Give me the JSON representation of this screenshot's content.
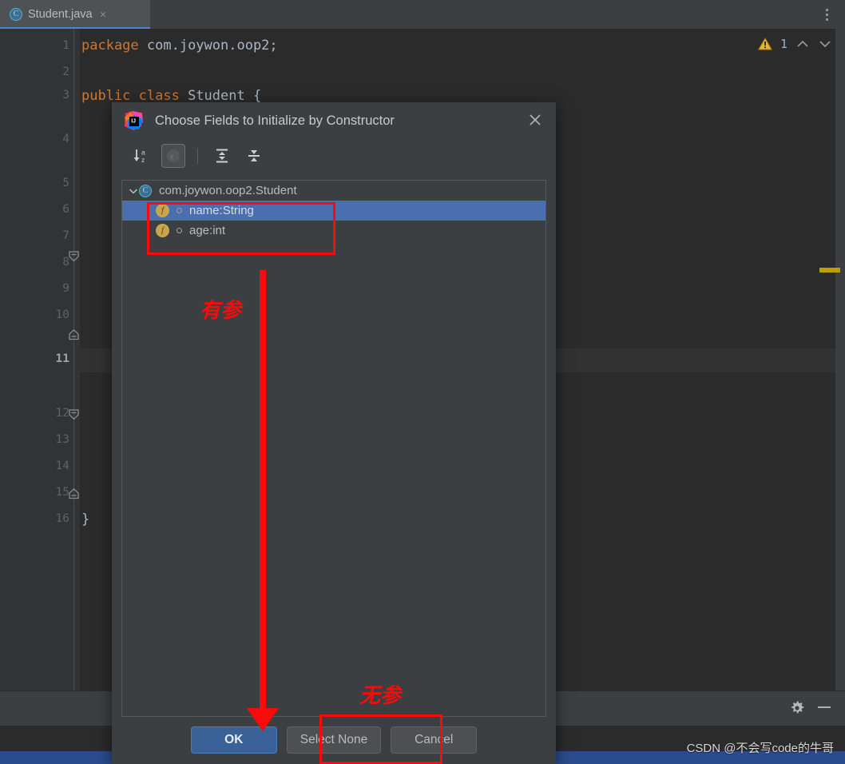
{
  "ide": {
    "tab": {
      "label": "Student.java",
      "icon": "java-class-icon",
      "close": "×"
    },
    "kebab_menu": "more-options",
    "inspections": {
      "warning_count": "1",
      "warning_icon": "warning-triangle-icon",
      "prev": "chevron-up-icon",
      "next": "chevron-down-icon"
    },
    "gutter": {
      "lines": [
        "1",
        "2",
        "3",
        "4",
        "5",
        "6",
        "7",
        "8",
        "9",
        "10",
        "11",
        "12",
        "13",
        "14",
        "15",
        "16"
      ],
      "current_line": "11"
    },
    "code": [
      {
        "line": 1,
        "tokens": [
          {
            "t": "kw",
            "v": "package"
          },
          {
            "t": "id",
            "v": " com.joywon.oop2;"
          }
        ]
      },
      {
        "line": 3,
        "tokens": [
          {
            "t": "kw",
            "v": "public class"
          },
          {
            "t": "id",
            "v": " Student {"
          }
        ]
      },
      {
        "line": 16,
        "tokens": [
          {
            "t": "id",
            "v": "}"
          }
        ]
      }
    ],
    "toolwindow": {
      "gear": "settings-gear-icon",
      "minimize": "minimize-icon"
    },
    "watermark": "CSDN @不会写code的牛哥"
  },
  "dialog": {
    "title": "Choose Fields to Initialize by Constructor",
    "logo": "intellij-idea-logo",
    "close": "close-icon",
    "toolbar": [
      {
        "name": "sort-alphabetically-icon",
        "label": "Sort alphabetically",
        "toggled": false
      },
      {
        "name": "show-class-toggle-icon",
        "label": "c",
        "toggled": true
      },
      {
        "name": "expand-all-icon",
        "label": "Expand all",
        "toggled": false
      },
      {
        "name": "collapse-all-icon",
        "label": "Collapse all",
        "toggled": false
      }
    ],
    "tree": {
      "root": {
        "label": "com.joywon.oop2.Student",
        "icon": "java-class-icon",
        "expanded": true
      },
      "fields": [
        {
          "label": "name:String",
          "icon": "field-icon",
          "selected": true
        },
        {
          "label": "age:int",
          "icon": "field-icon",
          "selected": false
        }
      ]
    },
    "buttons": [
      {
        "name": "ok-button",
        "label": "OK",
        "style": "default"
      },
      {
        "name": "select-none-button",
        "label": "Select None",
        "style": "normal"
      },
      {
        "name": "cancel-button",
        "label": "Cancel",
        "style": "normal"
      }
    ]
  },
  "annotations": {
    "color": "#fa0a0a",
    "with_params_label": "有参",
    "no_params_label": "无参"
  }
}
